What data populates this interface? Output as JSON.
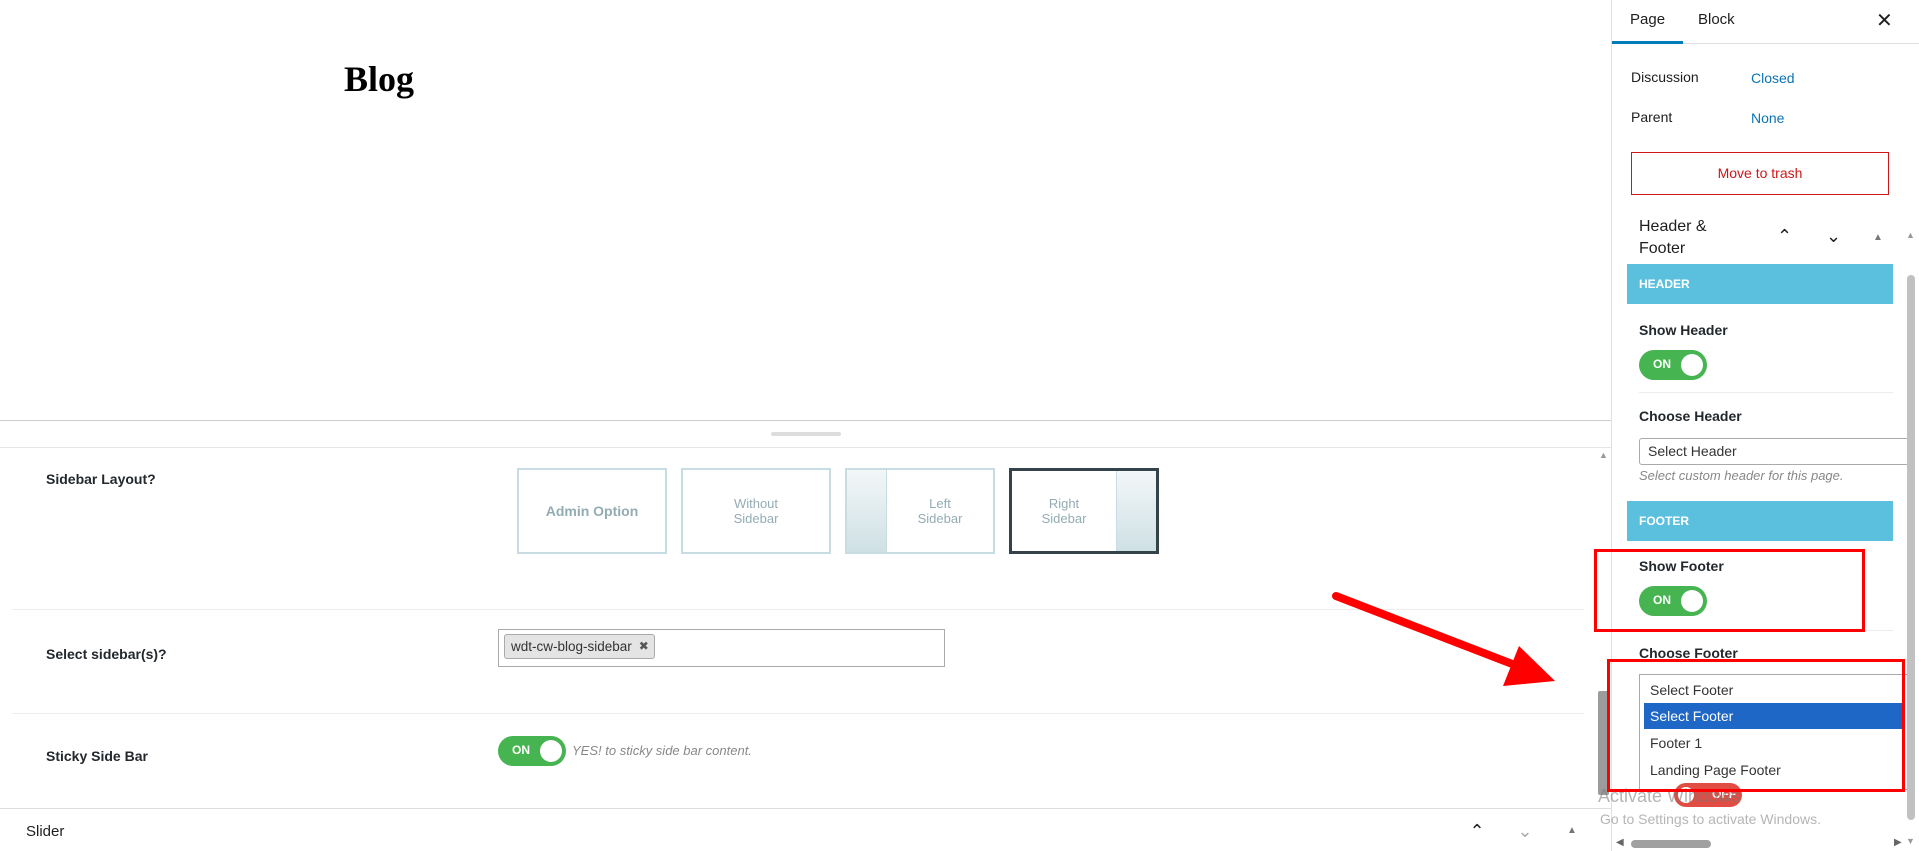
{
  "post": {
    "title": "Blog"
  },
  "meta": {
    "sidebar_layout": {
      "label": "Sidebar Layout?",
      "options": [
        {
          "label": "Admin Option",
          "variant": "bold",
          "selected": false
        },
        {
          "label": "Without Sidebar",
          "variant": "none",
          "selected": false
        },
        {
          "label": "Left Sidebar",
          "variant": "left",
          "selected": false
        },
        {
          "label": "Right Sidebar",
          "variant": "right",
          "selected": true
        }
      ]
    },
    "select_sidebar": {
      "label": "Select sidebar(s)?",
      "tags": [
        "wdt-cw-blog-sidebar"
      ],
      "remove_glyph": "✖"
    },
    "sticky": {
      "label": "Sticky Side Bar",
      "toggle": "ON",
      "hint": "YES! to sticky side bar content."
    }
  },
  "bottom_panel": {
    "title": "Slider"
  },
  "sidebar": {
    "tabs": [
      {
        "label": "Page",
        "active": true
      },
      {
        "label": "Block",
        "active": false
      }
    ],
    "discussion": {
      "label": "Discussion",
      "value": "Closed"
    },
    "parent": {
      "label": "Parent",
      "value": "None"
    },
    "trash_label": "Move to trash",
    "hf": {
      "title": "Header & Footer",
      "header_section": "HEADER",
      "show_header": {
        "label": "Show Header",
        "toggle": "ON"
      },
      "choose_header": {
        "label": "Choose Header",
        "value": "Select Header",
        "help": "Select custom header for this page."
      },
      "footer_section": "FOOTER",
      "show_footer": {
        "label": "Show Footer",
        "toggle": "ON"
      },
      "choose_footer": {
        "label": "Choose Footer",
        "value": "Select Footer",
        "options": [
          "Select Footer",
          "Footer 1",
          "Landing Page Footer"
        ],
        "selected_index": 0
      },
      "next_toggle": "OFF"
    }
  },
  "os_watermark": {
    "title": "Activate Windows",
    "subtitle": "Go to Settings to activate Windows."
  },
  "colors": {
    "accent": "#007cba",
    "section_bar": "#5bc0de",
    "toggle_on": "#46b450",
    "toggle_off": "#e14d43",
    "annotation": "#ff0000",
    "trash": "#cc1818",
    "dropdown_selected": "#1e67c7"
  },
  "icons": {
    "close": "close-icon",
    "chevron_up": "chevron-up-icon",
    "chevron_down": "chevron-down-icon",
    "collapse": "triangle-up-icon"
  }
}
